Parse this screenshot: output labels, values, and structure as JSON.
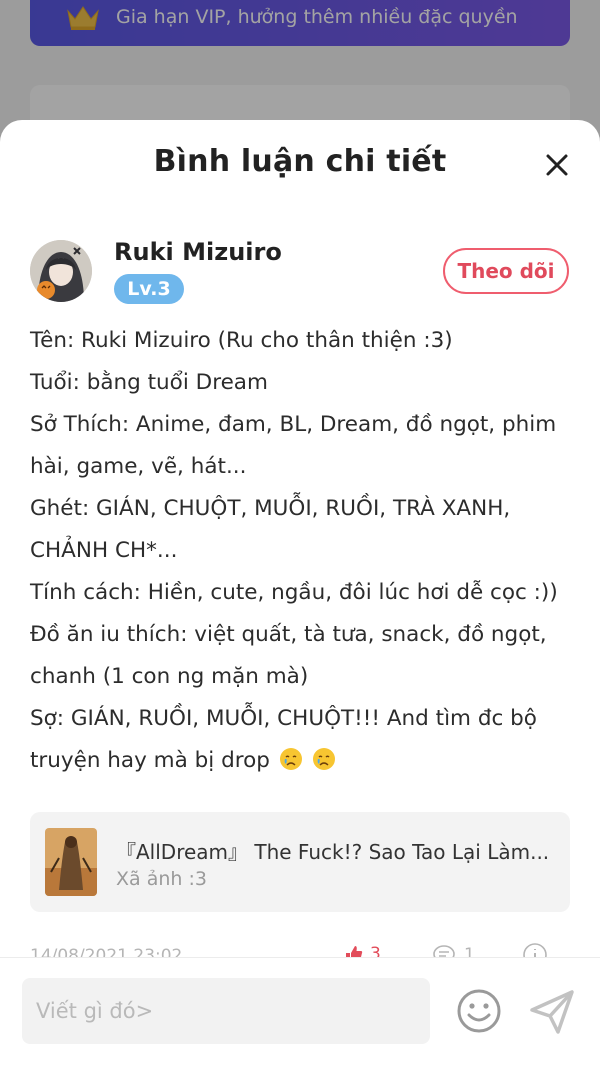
{
  "background": {
    "vip_banner_text": "Gia hạn VIP, hưởng thêm nhiều đặc quyền"
  },
  "sheet": {
    "title": "Bình luận chi tiết",
    "close_icon": "close-icon"
  },
  "author": {
    "name": "Ruki Mizuiro",
    "level": "Lv.3",
    "follow_label": "Theo dõi"
  },
  "comment": {
    "lines": [
      "Tên: Ruki Mizuiro (Ru cho thân thiện :3)",
      "Tuổi: bằng tuổi Dream",
      "Sở Thích: Anime, đam, BL, Dream, đồ ngọt, phim",
      "hài, game, vẽ, hát...",
      "Ghét: GIÁN, CHUỘT, MUỖI, RUỒI, TRÀ XANH,",
      "CHẢNH CH*...",
      "Tính cách: Hiền, cute, ngầu, đôi lúc hơi dễ cọc :))",
      "Đồ ăn iu thích: việt quất, tà tưa, snack, đồ ngọt,",
      "chanh (1 con ng mặn mà)",
      "Sợ: GIÁN, RUỒI, MUỖI, CHUỘT!!! And tìm đc bộ",
      "truyện hay mà bị drop"
    ],
    "trailing_emoji": "crying-face-icon"
  },
  "story": {
    "title": "『AllDream』 The Fuck!? Sao Tao Lại Làm...",
    "subtitle": "Xã ảnh :3"
  },
  "meta": {
    "date": "14/08/2021 23:02",
    "likes": "3",
    "replies": "1"
  },
  "composer": {
    "placeholder": "Viết gì đó>"
  },
  "colors": {
    "accent_red": "#e04a5c",
    "level_blue": "#6fb7ec",
    "vip_purple": "#6a5ae7"
  }
}
